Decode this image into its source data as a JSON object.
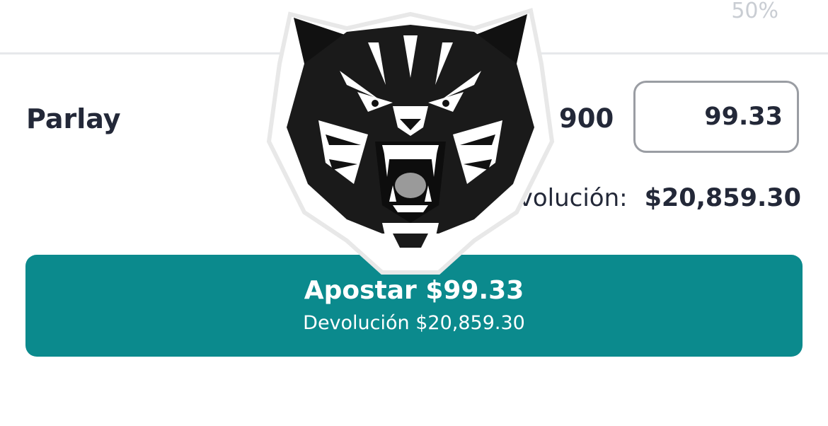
{
  "header": {
    "percent_text": "50%"
  },
  "bet": {
    "type_label": "Parlay",
    "odds_text": "900",
    "stake_value": "99.33",
    "return_label": "Devolución:",
    "return_value": "$20,859.30"
  },
  "action_button": {
    "title": "Apostar $99.33",
    "subtitle": "Devolución $20,859.30"
  },
  "overlay": {
    "icon": "tiger-head-icon"
  },
  "colors": {
    "accent": "#0b8a8d",
    "text": "#232838",
    "muted": "#c9cdd3"
  }
}
